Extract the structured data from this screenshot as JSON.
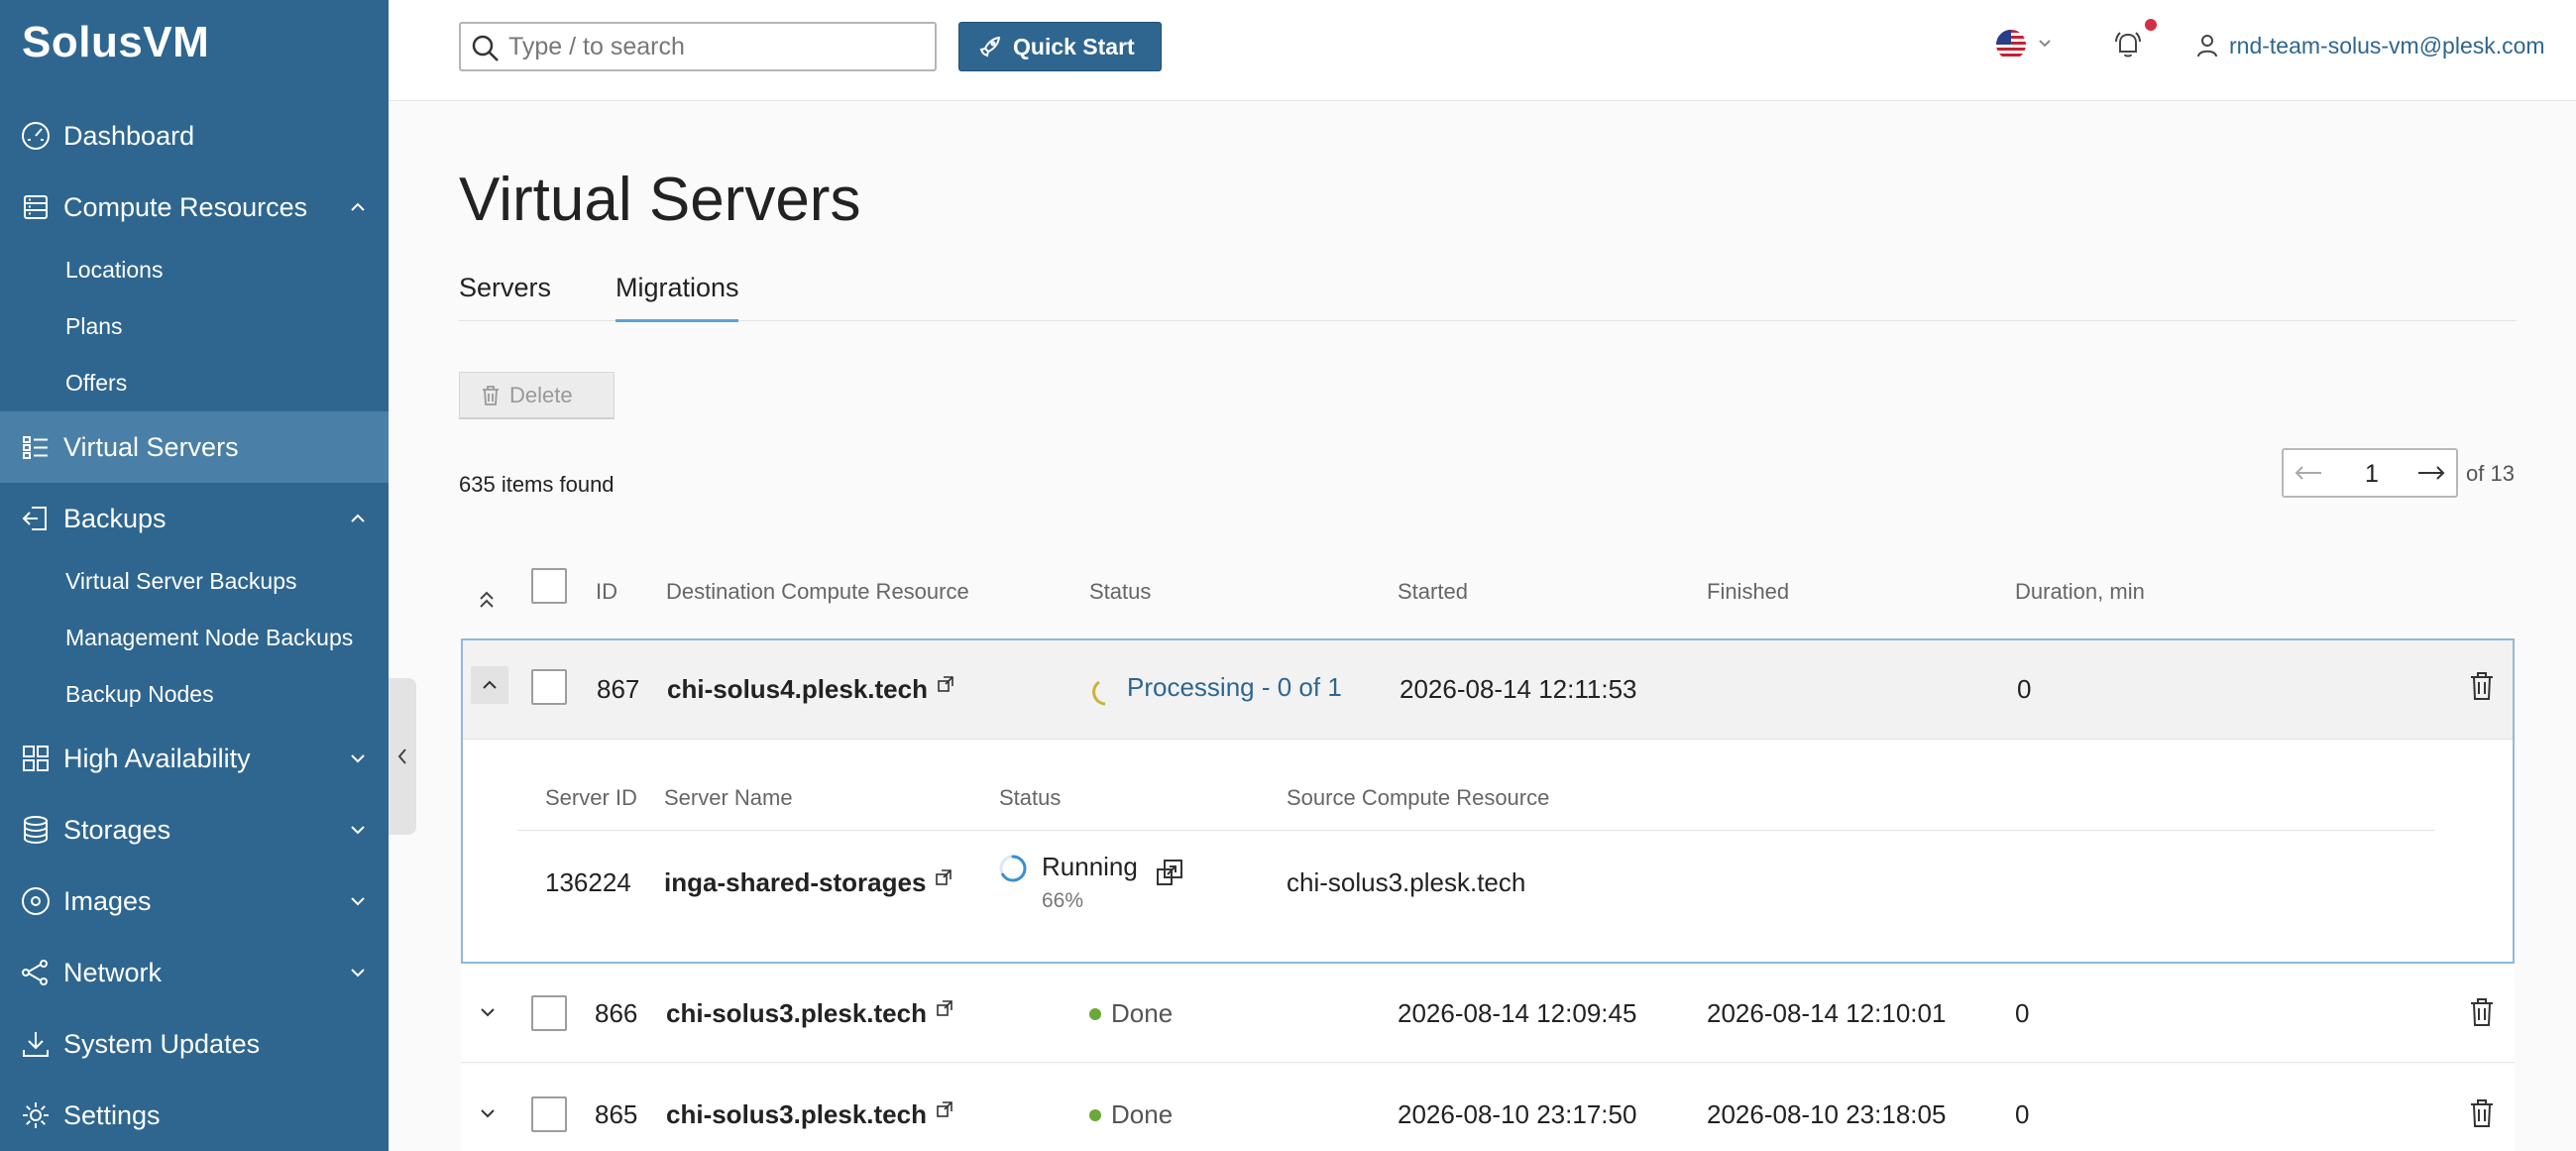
{
  "app": {
    "logo": "SolusVM"
  },
  "sidebar": {
    "items": [
      {
        "label": "Dashboard",
        "icon": "gauge-icon"
      },
      {
        "label": "Compute Resources",
        "icon": "server-icon",
        "expanded": true,
        "children": [
          "Locations",
          "Plans",
          "Offers"
        ]
      },
      {
        "label": "Virtual Servers",
        "icon": "virtual-servers-icon",
        "active": true
      },
      {
        "label": "Backups",
        "icon": "backup-icon",
        "expanded": true,
        "children": [
          "Virtual Server Backups",
          "Management Node Backups",
          "Backup Nodes"
        ]
      },
      {
        "label": "High Availability",
        "icon": "grid-icon"
      },
      {
        "label": "Storages",
        "icon": "database-icon"
      },
      {
        "label": "Images",
        "icon": "disc-icon"
      },
      {
        "label": "Network",
        "icon": "network-icon"
      },
      {
        "label": "System Updates",
        "icon": "download-icon"
      },
      {
        "label": "Settings",
        "icon": "gear-icon"
      }
    ]
  },
  "header": {
    "search_placeholder": "Type / to search",
    "quick_start": "Quick Start",
    "user_email": "rnd-team-solus-vm@plesk.com"
  },
  "page": {
    "title": "Virtual Servers",
    "tabs": [
      "Servers",
      "Migrations"
    ],
    "active_tab": "Migrations",
    "delete_label": "Delete",
    "items_found": "635 items found",
    "pagination": {
      "current": "1",
      "of_label": "of 13"
    }
  },
  "table": {
    "columns": [
      "ID",
      "Destination Compute Resource",
      "Status",
      "Started",
      "Finished",
      "Duration, min"
    ],
    "rows": [
      {
        "id": "867",
        "destination": "chi-solus4.plesk.tech",
        "status": "Processing - 0 of 1",
        "started": "2026-08-14 12:11:53",
        "finished": "",
        "duration": "0"
      },
      {
        "id": "866",
        "destination": "chi-solus3.plesk.tech",
        "status": "Done",
        "started": "2026-08-14 12:09:45",
        "finished": "2026-08-14 12:10:01",
        "duration": "0"
      },
      {
        "id": "865",
        "destination": "chi-solus3.plesk.tech",
        "status": "Done",
        "started": "2026-08-10 23:17:50",
        "finished": "2026-08-10 23:18:05",
        "duration": "0"
      }
    ],
    "sub_table": {
      "columns": [
        "Server ID",
        "Server Name",
        "Status",
        "Source Compute Resource"
      ],
      "row": {
        "server_id": "136224",
        "server_name": "inga-shared-storages",
        "status": "Running",
        "progress": "66%",
        "progress_value": 66,
        "source": "chi-solus3.plesk.tech"
      }
    }
  },
  "colors": {
    "sidebar": "#2e6690",
    "sidebar_active": "#4a80a8",
    "accent": "#5aa3d6",
    "done": "#6aa83a",
    "notification": "#d32f45"
  }
}
